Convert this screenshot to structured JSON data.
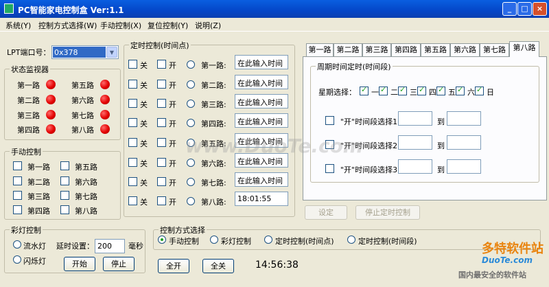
{
  "window": {
    "title": "PC智能家电控制盒    Ver:1.1",
    "minimize": "_",
    "maximize": "□",
    "close": "×"
  },
  "menu": [
    "系统(Y)",
    "控制方式选择(W)",
    "手动控制(X)",
    "复位控制(Y)",
    "说明(Z)"
  ],
  "port": {
    "label": "LPT端口号：",
    "value": "0x378"
  },
  "status_monitor": {
    "title": "状态监视器",
    "channels": [
      "第一路",
      "第二路",
      "第三路",
      "第四路",
      "第五路",
      "第六路",
      "第七路",
      "第八路"
    ],
    "led_color": "#e30000"
  },
  "manual": {
    "title": "手动控制",
    "channels": [
      "第一路",
      "第二路",
      "第三路",
      "第四路",
      "第五路",
      "第六路",
      "第七路",
      "第八路"
    ]
  },
  "timer": {
    "title": "定时控制(时间点)",
    "off_label": "关",
    "on_label": "开",
    "rows": [
      {
        "label": "第一路:",
        "value": "在此输入时间"
      },
      {
        "label": "第二路:",
        "value": "在此输入时间"
      },
      {
        "label": "第三路:",
        "value": "在此输入时间"
      },
      {
        "label": "第四路:",
        "value": "在此输入时间"
      },
      {
        "label": "第五路:",
        "value": "在此输入时间"
      },
      {
        "label": "第六路:",
        "value": "在此输入时间"
      },
      {
        "label": "第七路:",
        "value": "在此输入时间"
      },
      {
        "label": "第八路:",
        "value": "18:01:55"
      }
    ]
  },
  "tabs": [
    "第一路",
    "第二路",
    "第三路",
    "第四路",
    "第五路",
    "第六路",
    "第七路",
    "第八路"
  ],
  "period": {
    "title": "周期时间定时(时间段)",
    "week_label": "星期选择：",
    "days": [
      "一",
      "二",
      "三",
      "四",
      "五",
      "六",
      "日"
    ],
    "ranges": [
      {
        "label": "\"开\"时间段选择1:",
        "to": "到"
      },
      {
        "label": "\"开\"时间段选择2:",
        "to": "到"
      },
      {
        "label": "\"开\"时间段选择3:",
        "to": "到"
      }
    ],
    "set_button": "设定",
    "stop_button": "停止定时控制"
  },
  "lights": {
    "title": "彩灯控制",
    "flow": "流水灯",
    "flash": "闪烁灯",
    "delay_label": "延时设置：",
    "delay_value": "200",
    "unit": "毫秒",
    "start": "开始",
    "stop": "停止"
  },
  "mode": {
    "title": "控制方式选择",
    "options": [
      "手动控制",
      "彩灯控制",
      "定时控制(时间点)",
      "定时控制(时间段)"
    ]
  },
  "bottom": {
    "all_on": "全开",
    "all_off": "全关",
    "clock": "14:56:38"
  },
  "watermark": {
    "center": "www.DuoTe.com",
    "brand": "多特软件站",
    "brand_url": "DuoTe.com",
    "slogan": "国内最安全的软件站"
  }
}
